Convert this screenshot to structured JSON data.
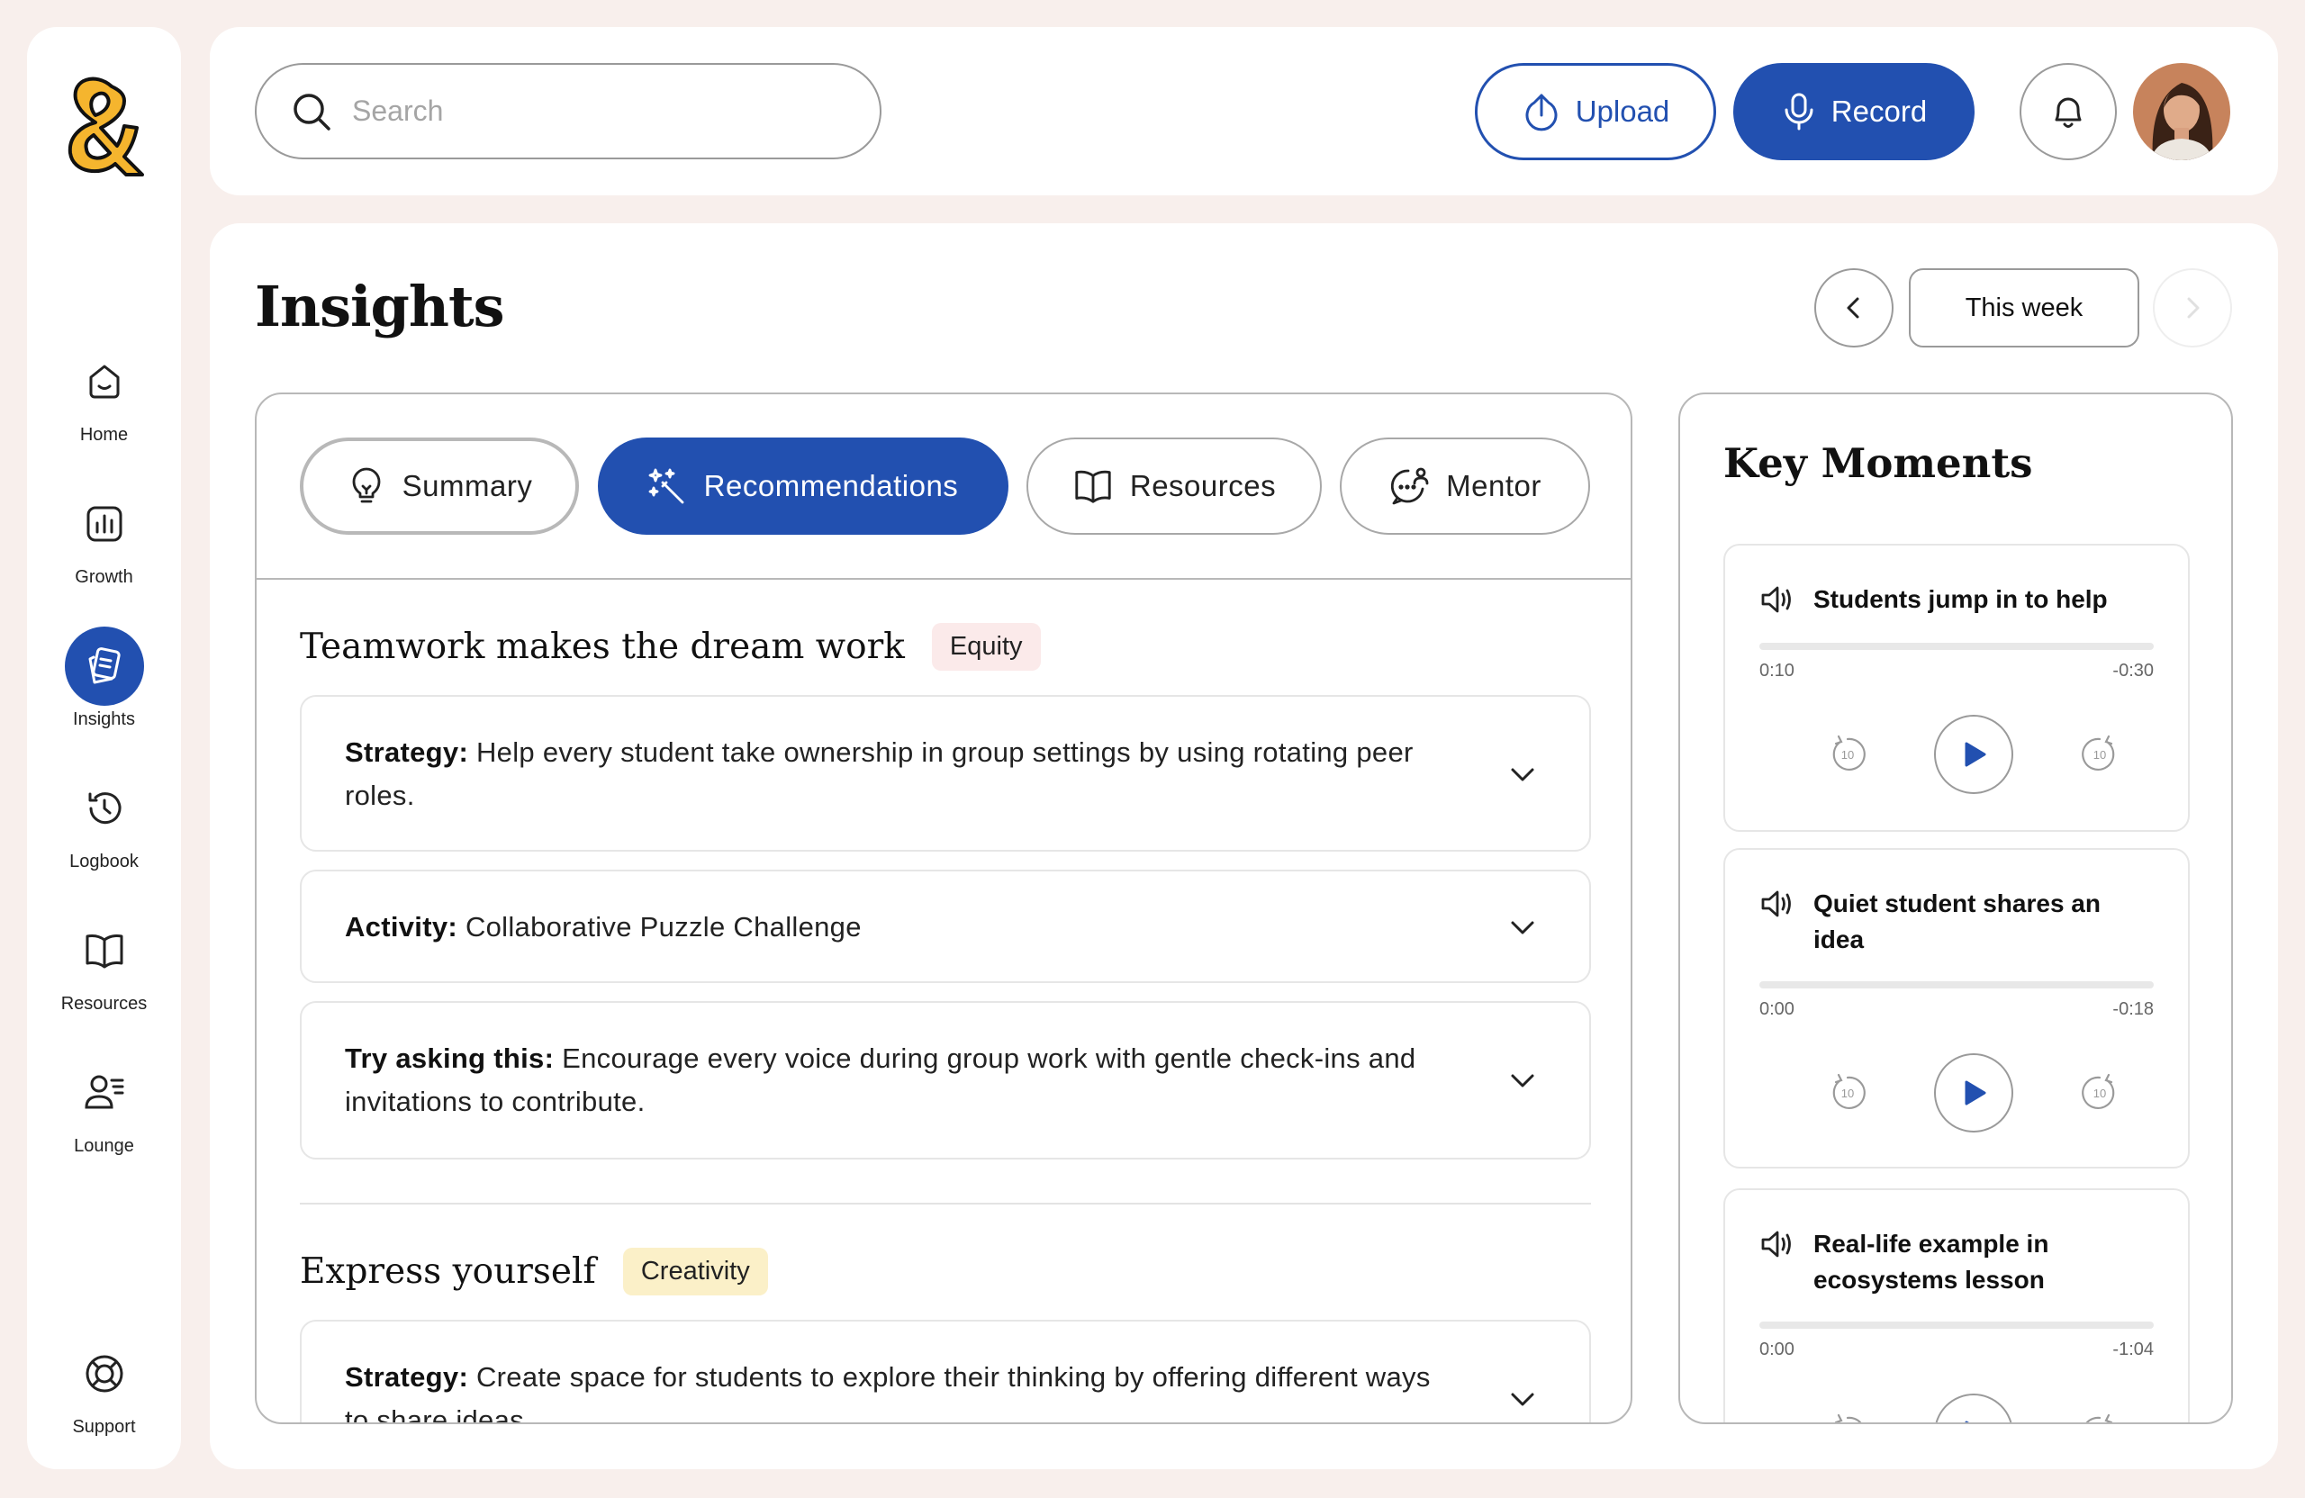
{
  "colors": {
    "brand_blue": "#2250b0",
    "logo_yellow": "#f5b52e",
    "background": "#f8efec",
    "equity_tag": "#fbeaea",
    "creativity_tag": "#fbf0c8"
  },
  "sidebar": {
    "logo_icon": "ampersand-logo",
    "items": [
      {
        "label": "Home",
        "icon": "home-icon"
      },
      {
        "label": "Growth",
        "icon": "chart-icon"
      },
      {
        "label": "Insights",
        "icon": "insights-icon",
        "active": true
      },
      {
        "label": "Logbook",
        "icon": "history-icon"
      },
      {
        "label": "Resources",
        "icon": "book-icon"
      },
      {
        "label": "Lounge",
        "icon": "people-icon"
      }
    ],
    "support": {
      "label": "Support",
      "icon": "lifebuoy-icon"
    }
  },
  "header": {
    "search_placeholder": "Search",
    "upload_label": "Upload",
    "record_label": "Record"
  },
  "main": {
    "title": "Insights",
    "period_label": "This week",
    "tabs": [
      {
        "label": "Summary",
        "icon": "lightbulb-icon"
      },
      {
        "label": "Recommendations",
        "icon": "magic-wand-icon",
        "active": true
      },
      {
        "label": "Resources",
        "icon": "book-icon"
      },
      {
        "label": "Mentor",
        "icon": "chat-person-icon"
      }
    ],
    "sections": [
      {
        "title": "Teamwork makes the dream work",
        "tag": "Equity",
        "items": [
          {
            "kind": "Strategy:",
            "text": "Help every student take ownership in group settings by using rotating peer roles."
          },
          {
            "kind": "Activity:",
            "text": "Collaborative Puzzle Challenge"
          },
          {
            "kind": "Try asking this:",
            "text": "Encourage every voice during group work with gentle check-ins and invitations to contribute."
          }
        ]
      },
      {
        "title": "Express yourself",
        "tag": "Creativity",
        "items": [
          {
            "kind": "Strategy:",
            "text": "Create space for students to explore their thinking by offering different ways to share ideas."
          }
        ]
      }
    ]
  },
  "key_moments": {
    "title": "Key Moments",
    "skip_seconds": "10",
    "items": [
      {
        "title": "Students jump in to help",
        "elapsed": "0:10",
        "remaining": "-0:30"
      },
      {
        "title": "Quiet student shares an idea",
        "elapsed": "0:00",
        "remaining": "-0:18"
      },
      {
        "title": "Real-life example in ecosystems lesson",
        "elapsed": "0:00",
        "remaining": "-1:04"
      }
    ]
  }
}
